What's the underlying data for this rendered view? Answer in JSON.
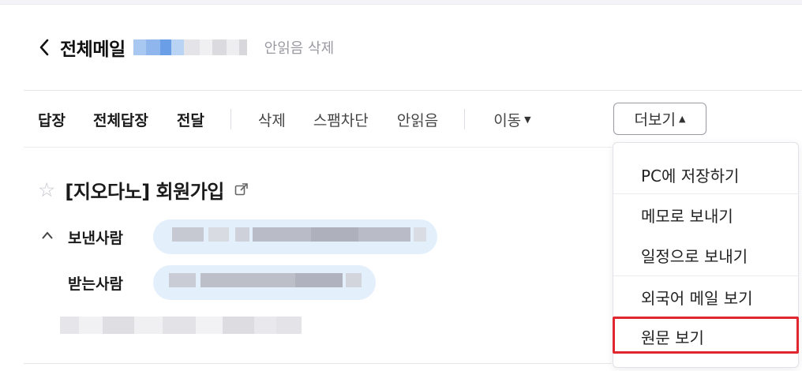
{
  "header": {
    "title": "전체메일",
    "unread_delete": "안읽음 삭제"
  },
  "toolbar": {
    "reply": "답장",
    "reply_all": "전체답장",
    "forward": "전달",
    "delete": "삭제",
    "spam_block": "스팸차단",
    "mark_unread": "안읽음",
    "move": "이동",
    "more": "더보기"
  },
  "mail": {
    "subject": "[지오다노] 회원가입",
    "sender_label": "보낸사람",
    "recipient_label": "받는사람"
  },
  "more_menu": {
    "items": [
      "PC에 저장하기",
      "메모로 보내기",
      "일정으로 보내기",
      "외국어 메일 보기",
      "원문 보기"
    ],
    "highlighted_item": "원문 보기"
  },
  "colors": {
    "accent_blue": "#e4effc",
    "highlight_red": "#e0262f",
    "muted_text": "#9a9aa3"
  },
  "icons": {
    "back": "chevron-left-icon",
    "star": "star-outline-icon",
    "external_link": "external-link-icon",
    "collapse": "chevron-up-icon"
  }
}
